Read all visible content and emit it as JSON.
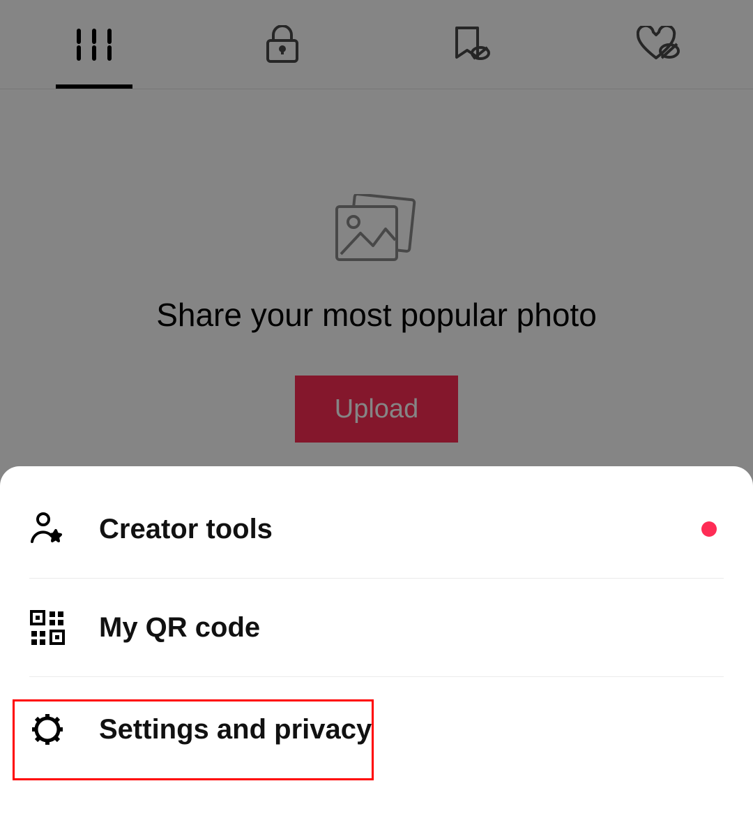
{
  "tabs": {
    "grid": "grid-tab",
    "private": "private-tab",
    "saved": "saved-tab",
    "liked": "liked-tab"
  },
  "empty_state": {
    "prompt": "Share your most popular photo",
    "upload_button": "Upload"
  },
  "menu": {
    "creator_tools": "Creator tools",
    "qr_code": "My QR code",
    "settings_privacy": "Settings and privacy"
  },
  "colors": {
    "accent": "#fe2c55"
  }
}
